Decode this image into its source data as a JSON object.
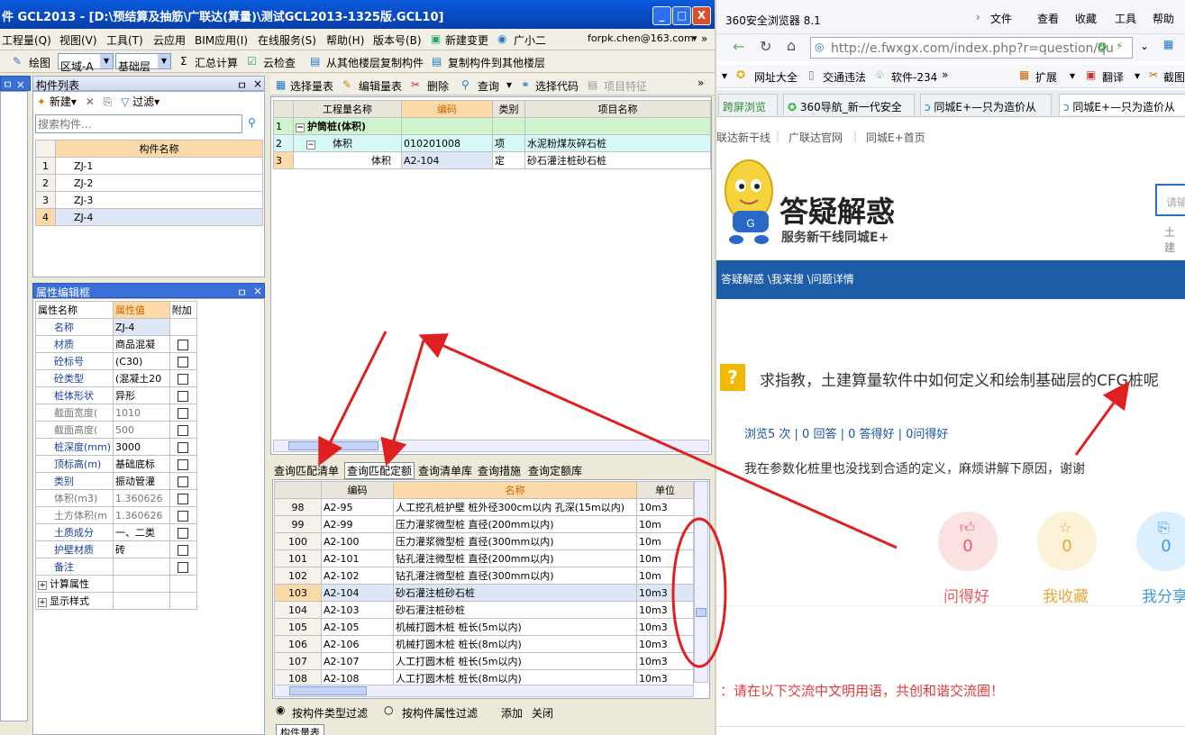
{
  "gcl": {
    "title": "件 GCL2013 - [D:\\预结算及抽筋\\广联达(算量)\\测试GCL2013-1325版.GCL10]",
    "window_buttons": {
      "minimize": "_",
      "maximize": "□",
      "close": "X"
    },
    "menu": {
      "items": [
        "工程量(Q)",
        "视图(V)",
        "工具(T)",
        "云应用",
        "BIM应用(I)",
        "在线服务(S)",
        "帮助(H)",
        "版本号(B)",
        "新建变更",
        "广小二"
      ],
      "user": "forpk.chen@163.com",
      "more": "»"
    },
    "toolbar": {
      "draw": "绘图",
      "region": "区域-A",
      "layer": "基础层",
      "sum": "汇总计算",
      "cloud_check": "云检查",
      "copy_from": "从其他楼层复制构件",
      "copy_to": "复制构件到其他楼层"
    },
    "pin": "ㅁ",
    "component_list": {
      "title": "构件列表",
      "new": "新建",
      "filter": "过滤",
      "search_placeholder": "搜索构件...",
      "column": "构件名称",
      "rows": [
        {
          "n": "1",
          "name": "ZJ-1"
        },
        {
          "n": "2",
          "name": "ZJ-2"
        },
        {
          "n": "3",
          "name": "ZJ-3"
        },
        {
          "n": "4",
          "name": "ZJ-4"
        }
      ]
    },
    "props": {
      "title": "属性编辑框",
      "col_name": "属性名称",
      "col_value": "属性值",
      "col_extra": "附加",
      "rows": [
        {
          "name": "名称",
          "value": "ZJ-4"
        },
        {
          "name": "材质",
          "value": "商品混凝"
        },
        {
          "name": "砼标号",
          "value": "(C30)"
        },
        {
          "name": "砼类型",
          "value": "(混凝土20"
        },
        {
          "name": "桩体形状",
          "value": "异形"
        },
        {
          "name": "截面宽度(",
          "value": "1010"
        },
        {
          "name": "截面高度(",
          "value": "500"
        },
        {
          "name": "桩深度(mm)",
          "value": "3000"
        },
        {
          "name": "顶标高(m)",
          "value": "基础底标"
        },
        {
          "name": "类别",
          "value": "振动管灌"
        },
        {
          "name": "体积(m3)",
          "value": "1.360626"
        },
        {
          "name": "土方体积(m",
          "value": "1.360626"
        },
        {
          "name": "土质成分",
          "value": "一、二类"
        },
        {
          "name": "护壁材质",
          "value": "砖"
        },
        {
          "name": "备注",
          "value": ""
        }
      ],
      "expand1": "计算属性",
      "expand2": "显示样式"
    },
    "quant": {
      "toolbar": {
        "select": "选择量表",
        "edit": "编辑量表",
        "delete": "删除",
        "query": "查询",
        "code": "选择代码",
        "feature": "项目特征",
        "more": "»"
      },
      "headers": [
        "工程量名称",
        "编码",
        "类别",
        "项目名称"
      ],
      "rows": [
        {
          "n": "1",
          "name": "护筒桩(体积)",
          "code": "",
          "type": "",
          "item": ""
        },
        {
          "n": "2",
          "name": "体积",
          "code": "010201008",
          "type": "项",
          "item": "水泥粉煤灰碎石桩"
        },
        {
          "n": "3",
          "name": "体积",
          "code": "A2-104",
          "type": "定",
          "item": "砂石灌注桩砂石桩"
        }
      ]
    },
    "lower_tabs": [
      "查询匹配清单",
      "查询匹配定额",
      "查询清单库",
      "查询措施",
      "查询定额库"
    ],
    "quota": {
      "headers": [
        "编码",
        "名称",
        "单位"
      ],
      "rows": [
        {
          "n": "98",
          "code": "A2-95",
          "name": "人工挖孔桩护壁 桩外径300cm以内 孔深(15m以内)",
          "unit": "10m3"
        },
        {
          "n": "99",
          "code": "A2-99",
          "name": "压力灌浆微型桩 直径(200mm以内)",
          "unit": "10m"
        },
        {
          "n": "100",
          "code": "A2-100",
          "name": "压力灌浆微型桩 直径(300mm以内)",
          "unit": "10m"
        },
        {
          "n": "101",
          "code": "A2-101",
          "name": "钻孔灌注微型桩 直径(200mm以内)",
          "unit": "10m"
        },
        {
          "n": "102",
          "code": "A2-102",
          "name": "钻孔灌注微型桩 直径(300mm以内)",
          "unit": "10m"
        },
        {
          "n": "103",
          "code": "A2-104",
          "name": "砂石灌注桩砂石桩",
          "unit": "10m3"
        },
        {
          "n": "104",
          "code": "A2-103",
          "name": "砂石灌注桩砂桩",
          "unit": "10m3"
        },
        {
          "n": "105",
          "code": "A2-105",
          "name": "机械打圆木桩 桩长(5m以内)",
          "unit": "10m3"
        },
        {
          "n": "106",
          "code": "A2-106",
          "name": "机械打圆木桩 桩长(8m以内)",
          "unit": "10m3"
        },
        {
          "n": "107",
          "code": "A2-107",
          "name": "人工打圆木桩 桩长(5m以内)",
          "unit": "10m3"
        },
        {
          "n": "108",
          "code": "A2-108",
          "name": "人工打圆木桩 桩长(8m以内)",
          "unit": "10m3"
        }
      ]
    },
    "filter_radio1": "按构件类型过滤",
    "filter_radio2": "按构件属性过滤",
    "add": "添加",
    "close": "关闭",
    "bottom_tab": "构件量表"
  },
  "browser": {
    "title": "360安全浏览器 8.1",
    "menu": [
      "文件",
      "查看",
      "收藏",
      "工具",
      "帮助"
    ],
    "url": "http://e.fwxgx.com/index.php?r=question/qu",
    "bookmarks": [
      "网址大全",
      "交通违法",
      "软件-234",
      "扩展",
      "翻译",
      "截图"
    ],
    "tabs": [
      "跨屏浏览",
      "360导航_新一代安全",
      "同城E+—只为造价从",
      "同城E+—只为造价从"
    ],
    "site_nav": [
      "联达新干线",
      "广联达官网",
      "同城E+首页"
    ],
    "logo_title": "答疑解惑",
    "logo_sub": "服务新干线同城E+",
    "search_hint": "请输",
    "cat": "土建",
    "breadcrumb": "答疑解惑 \\我来搜 \\问题详情",
    "question": "求指教，土建算量软件中如何定义和绘制基础层的CFG桩呢",
    "stats": "浏览5 次 | 0 回答 | 0 答得好 | 0问得好",
    "body": "我在参数化桩里也没找到合适的定义，麻烦讲解下原因，谢谢",
    "actions": [
      {
        "count": "0",
        "label": "问得好",
        "color": "#e95c5c"
      },
      {
        "count": "0",
        "label": "我收藏",
        "color": "#e6a83c"
      },
      {
        "count": "0",
        "label": "我分享",
        "color": "#3c9ce6"
      }
    ],
    "notice": "：请在以下交流中文明用语，共创和谐交流圈！"
  }
}
